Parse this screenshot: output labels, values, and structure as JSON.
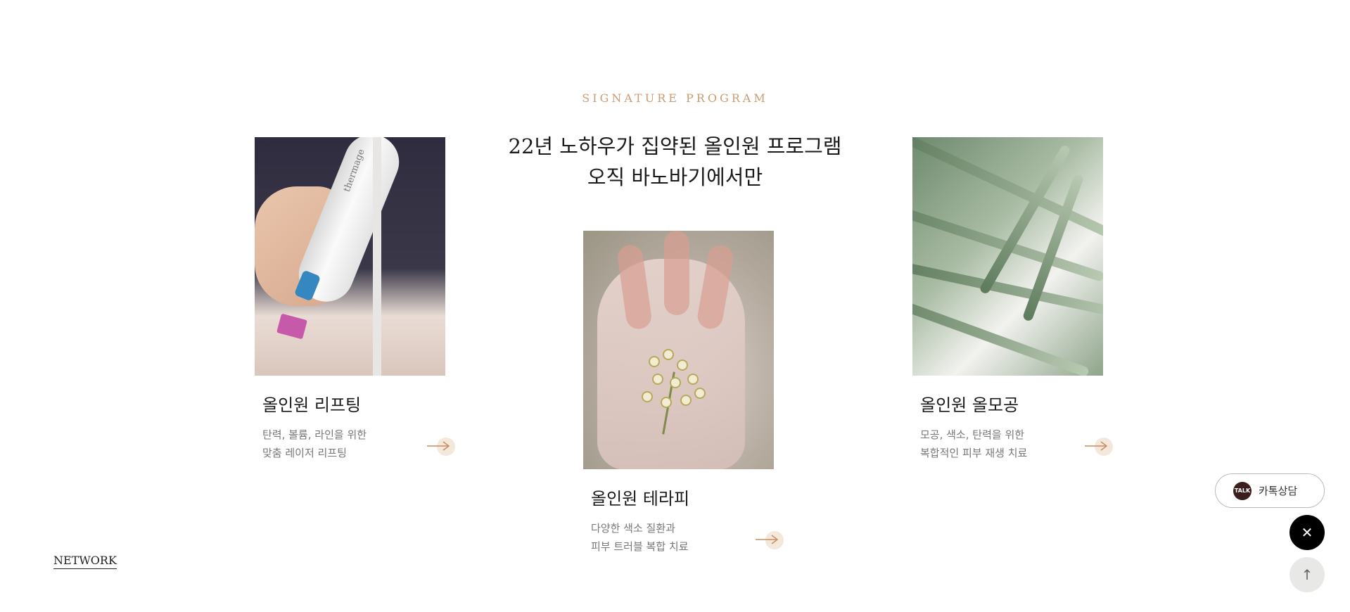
{
  "section": {
    "eyebrow": "SIGNATURE PROGRAM",
    "headline_line1": "22년 노하우가 집약된 올인원 프로그램",
    "headline_line2": "오직 바노바기에서만"
  },
  "cards": [
    {
      "title": "올인원 리프팅",
      "desc_line1": "탄력, 볼륨, 라인을 위한",
      "desc_line2": "맞춤 레이저 리프팅",
      "image_logo_text": "thermage"
    },
    {
      "title": "올인원 테라피",
      "desc_line1": "다양한 색소 질환과",
      "desc_line2": "피부 트러블 복합 치료"
    },
    {
      "title": "올인원 올모공",
      "desc_line1": "모공, 색소, 탄력을 위한",
      "desc_line2": "복합적인 피부 재생 치료"
    }
  ],
  "footer": {
    "network_link": "NETWORK"
  },
  "floating": {
    "talk_badge": "TALK",
    "talk_label": "카톡상담",
    "close_symbol": "✕",
    "top_symbol": "↑"
  },
  "colors": {
    "accent": "#c99c74",
    "arrow_bg": "#f4e8db"
  },
  "icons": [
    "arrow-right-icon",
    "kakao-talk-icon",
    "close-icon",
    "arrow-up-icon"
  ]
}
